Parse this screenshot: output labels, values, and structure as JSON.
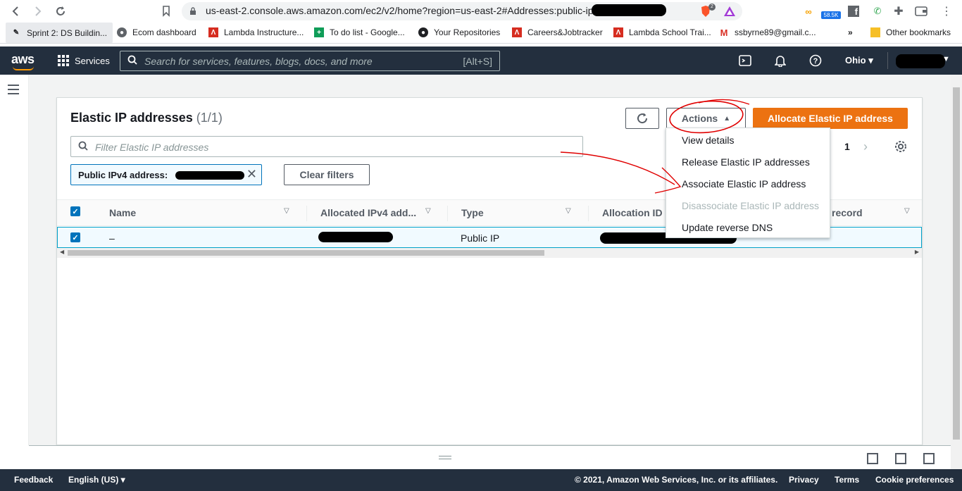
{
  "browser": {
    "url": "us-east-2.console.aws.amazon.com/ec2/v2/home?region=us-east-2#Addresses:public-ip=",
    "brave_badge": "2",
    "ext_badge": "58.5K"
  },
  "bookmarks": [
    {
      "label": "Sprint 2: DS Buildin..."
    },
    {
      "label": "Ecom dashboard"
    },
    {
      "label": "Lambda Instructure..."
    },
    {
      "label": "To do list - Google..."
    },
    {
      "label": "Your Repositories"
    },
    {
      "label": "Careers&Jobtracker"
    },
    {
      "label": "Lambda School Trai..."
    },
    {
      "label": "ssbyrne89@gmail.c..."
    },
    {
      "label": "Other bookmarks"
    }
  ],
  "aws_nav": {
    "logo": "aws",
    "services": "Services",
    "search_placeholder": "Search for services, features, blogs, docs, and more",
    "search_shortcut": "[Alt+S]",
    "region": "Ohio"
  },
  "main": {
    "title": "Elastic IP addresses",
    "count": "(1/1)",
    "actions_label": "Actions",
    "allocate_label": "Allocate Elastic IP address",
    "filter_placeholder": "Filter Elastic IP addresses",
    "token_label": "Public IPv4 address: ",
    "clear_filters": "Clear filters",
    "page_number": "1"
  },
  "table": {
    "columns": [
      "Name",
      "Allocated IPv4 add...",
      "Type",
      "Allocation ID",
      "record"
    ],
    "rows": [
      {
        "name": "–",
        "type": "Public IP"
      }
    ]
  },
  "actions_menu": [
    {
      "label": "View details",
      "enabled": true
    },
    {
      "label": "Release Elastic IP addresses",
      "enabled": true
    },
    {
      "label": "Associate Elastic IP address",
      "enabled": true
    },
    {
      "label": "Disassociate Elastic IP address",
      "enabled": false
    },
    {
      "label": "Update reverse DNS",
      "enabled": true
    }
  ],
  "footer": {
    "feedback": "Feedback",
    "language": "English (US)",
    "copyright": "© 2021, Amazon Web Services, Inc. or its affiliates.",
    "privacy": "Privacy",
    "terms": "Terms",
    "cookies": "Cookie preferences"
  },
  "colors": {
    "aws_nav_bg": "#232f3e",
    "primary_button": "#ec7211",
    "selection_blue": "#0073bb",
    "annotation_red": "#e00000"
  }
}
